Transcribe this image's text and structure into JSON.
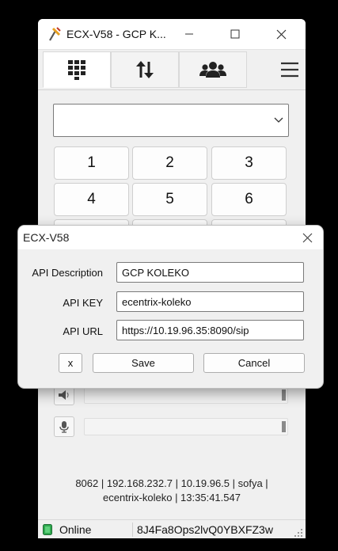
{
  "main_window": {
    "title": "ECX-V58 - GCP K...",
    "tabs": [
      {
        "name": "dialpad",
        "icon": "dialpad-icon"
      },
      {
        "name": "transfer",
        "icon": "transfer-arrows-icon"
      },
      {
        "name": "contacts",
        "icon": "contacts-group-icon"
      }
    ],
    "number_input_value": "",
    "keypad": [
      "1",
      "2",
      "3",
      "4",
      "5",
      "6"
    ],
    "speaker_volume_icon": "speaker-icon",
    "mic_volume_icon": "microphone-icon",
    "speaker_volume_level": 1.0,
    "mic_volume_level": 1.0,
    "status_info_line1": "8062 | 192.168.232.7 | 10.19.96.5 | sofya |",
    "status_info_line2": "ecentrix-koleko | 13:35:41.547",
    "status_bar": {
      "online_label": "Online",
      "session_token": "8J4Fa8Ops2lvQ0YBXFZ3w"
    }
  },
  "api_dialog": {
    "title": "ECX-V58",
    "fields": {
      "description_label": "API Description",
      "description_value": "GCP KOLEKO",
      "key_label": "API KEY",
      "key_value": "ecentrix-koleko",
      "url_label": "API URL",
      "url_value": "https://10.19.96.35:8090/sip"
    },
    "buttons": {
      "x_label": "x",
      "save_label": "Save",
      "cancel_label": "Cancel"
    }
  },
  "colors": {
    "online_green": "#2fa84f",
    "window_bg": "#f0f0f0",
    "desktop_bg": "#000000"
  }
}
